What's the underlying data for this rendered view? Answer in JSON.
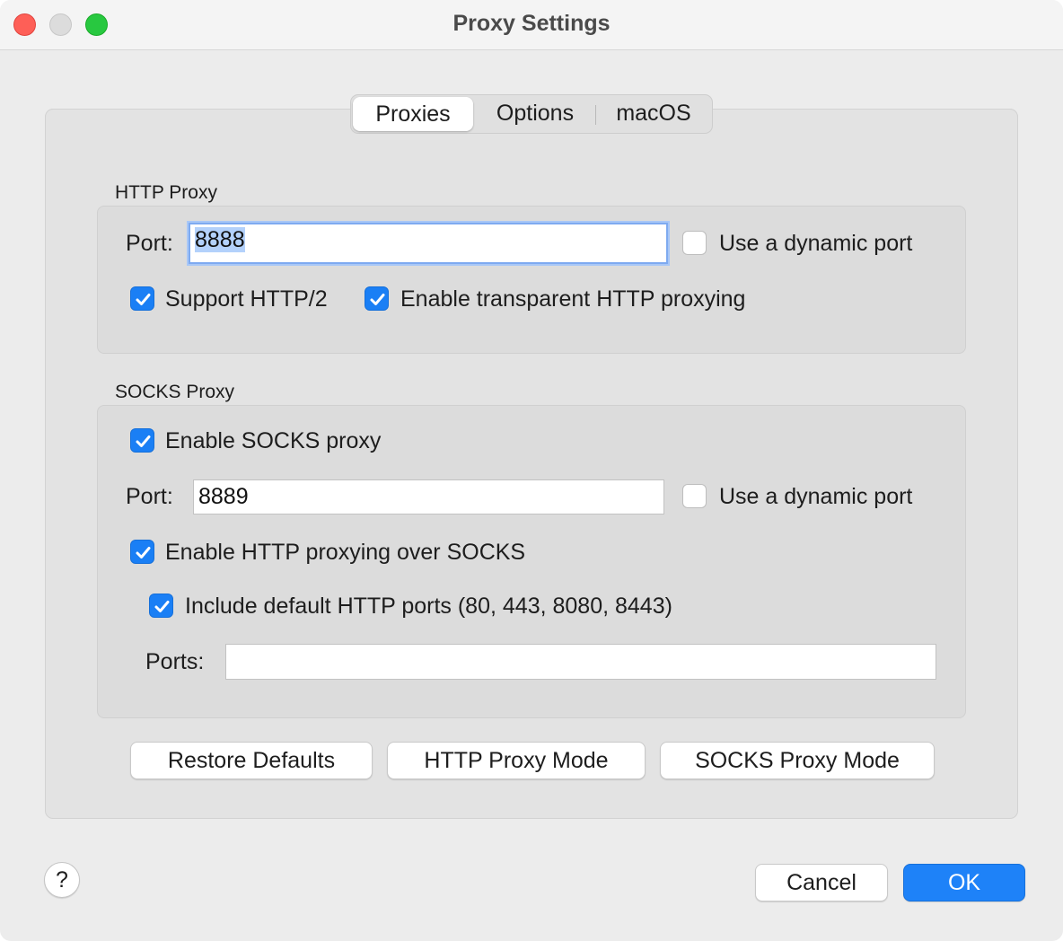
{
  "window": {
    "title": "Proxy Settings"
  },
  "tabs": [
    {
      "label": "Proxies",
      "selected": true
    },
    {
      "label": "Options",
      "selected": false
    },
    {
      "label": "macOS",
      "selected": false
    }
  ],
  "http_proxy": {
    "group_label": "HTTP Proxy",
    "port_label": "Port:",
    "port_value": "8888",
    "dynamic_port_label": "Use a dynamic port",
    "dynamic_port_checked": false,
    "support_http2_label": "Support HTTP/2",
    "support_http2_checked": true,
    "transparent_label": "Enable transparent HTTP proxying",
    "transparent_checked": true
  },
  "socks_proxy": {
    "group_label": "SOCKS Proxy",
    "enable_label": "Enable SOCKS proxy",
    "enable_checked": true,
    "port_label": "Port:",
    "port_value": "8889",
    "dynamic_port_label": "Use a dynamic port",
    "dynamic_port_checked": false,
    "http_over_socks_label": "Enable HTTP proxying over SOCKS",
    "http_over_socks_checked": true,
    "include_default_ports_label": "Include default HTTP ports (80, 443, 8080, 8443)",
    "include_default_ports_checked": true,
    "ports_label": "Ports:",
    "ports_value": ""
  },
  "actions": {
    "restore_defaults": "Restore Defaults",
    "http_proxy_mode": "HTTP Proxy Mode",
    "socks_proxy_mode": "SOCKS Proxy Mode"
  },
  "footer": {
    "help": "?",
    "cancel": "Cancel",
    "ok": "OK"
  },
  "colors": {
    "accent": "#1e82f8",
    "close": "#fe5f57",
    "zoom": "#28c840"
  }
}
